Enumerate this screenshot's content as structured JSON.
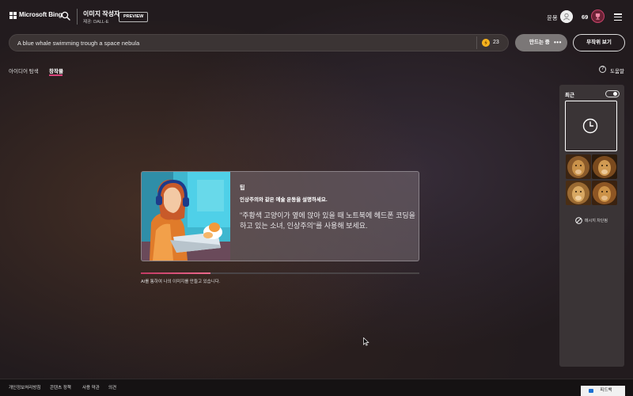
{
  "header": {
    "brand": "Microsoft Bing",
    "app_title": "이미지 작성자",
    "app_subtitle": "제공: DALL-E",
    "badge": "PREVIEW",
    "user_name": "윤용",
    "coins": "69"
  },
  "prompt": {
    "text": "A blue whale swimming trough a space nebula",
    "boosts": "23",
    "create_label": "만드는 중",
    "surprise_label": "무작위 보기"
  },
  "tabs": [
    {
      "label": "아이디어 탐색"
    },
    {
      "label": "창작물"
    }
  ],
  "help_label": "도움말",
  "tip": {
    "title": "팁",
    "body": "인상주의와 같은 예술 운동을 설명하세요.",
    "example": "\"주황색 고양이가 옆에 앉아 있을 때 노트북에 헤드폰 코딩을 하고 있는 소녀, 인상주의\"를 사용해 보세요."
  },
  "progress": {
    "fraction": 0.25,
    "status": "AI를 통하여 나의 이미지를 만들고 있습니다."
  },
  "recent": {
    "title": "최근",
    "toggle_on": true,
    "blocked_label": "메시지 차단됨"
  },
  "footer": {
    "links": [
      "개인정보처리방침",
      "콘텐츠 정책",
      "사용 약관",
      "의견"
    ],
    "feedback": "피드백"
  },
  "colors": {
    "accent": "#d8437a",
    "boost_coin": "#f6b21e",
    "background": "#221b1e"
  }
}
